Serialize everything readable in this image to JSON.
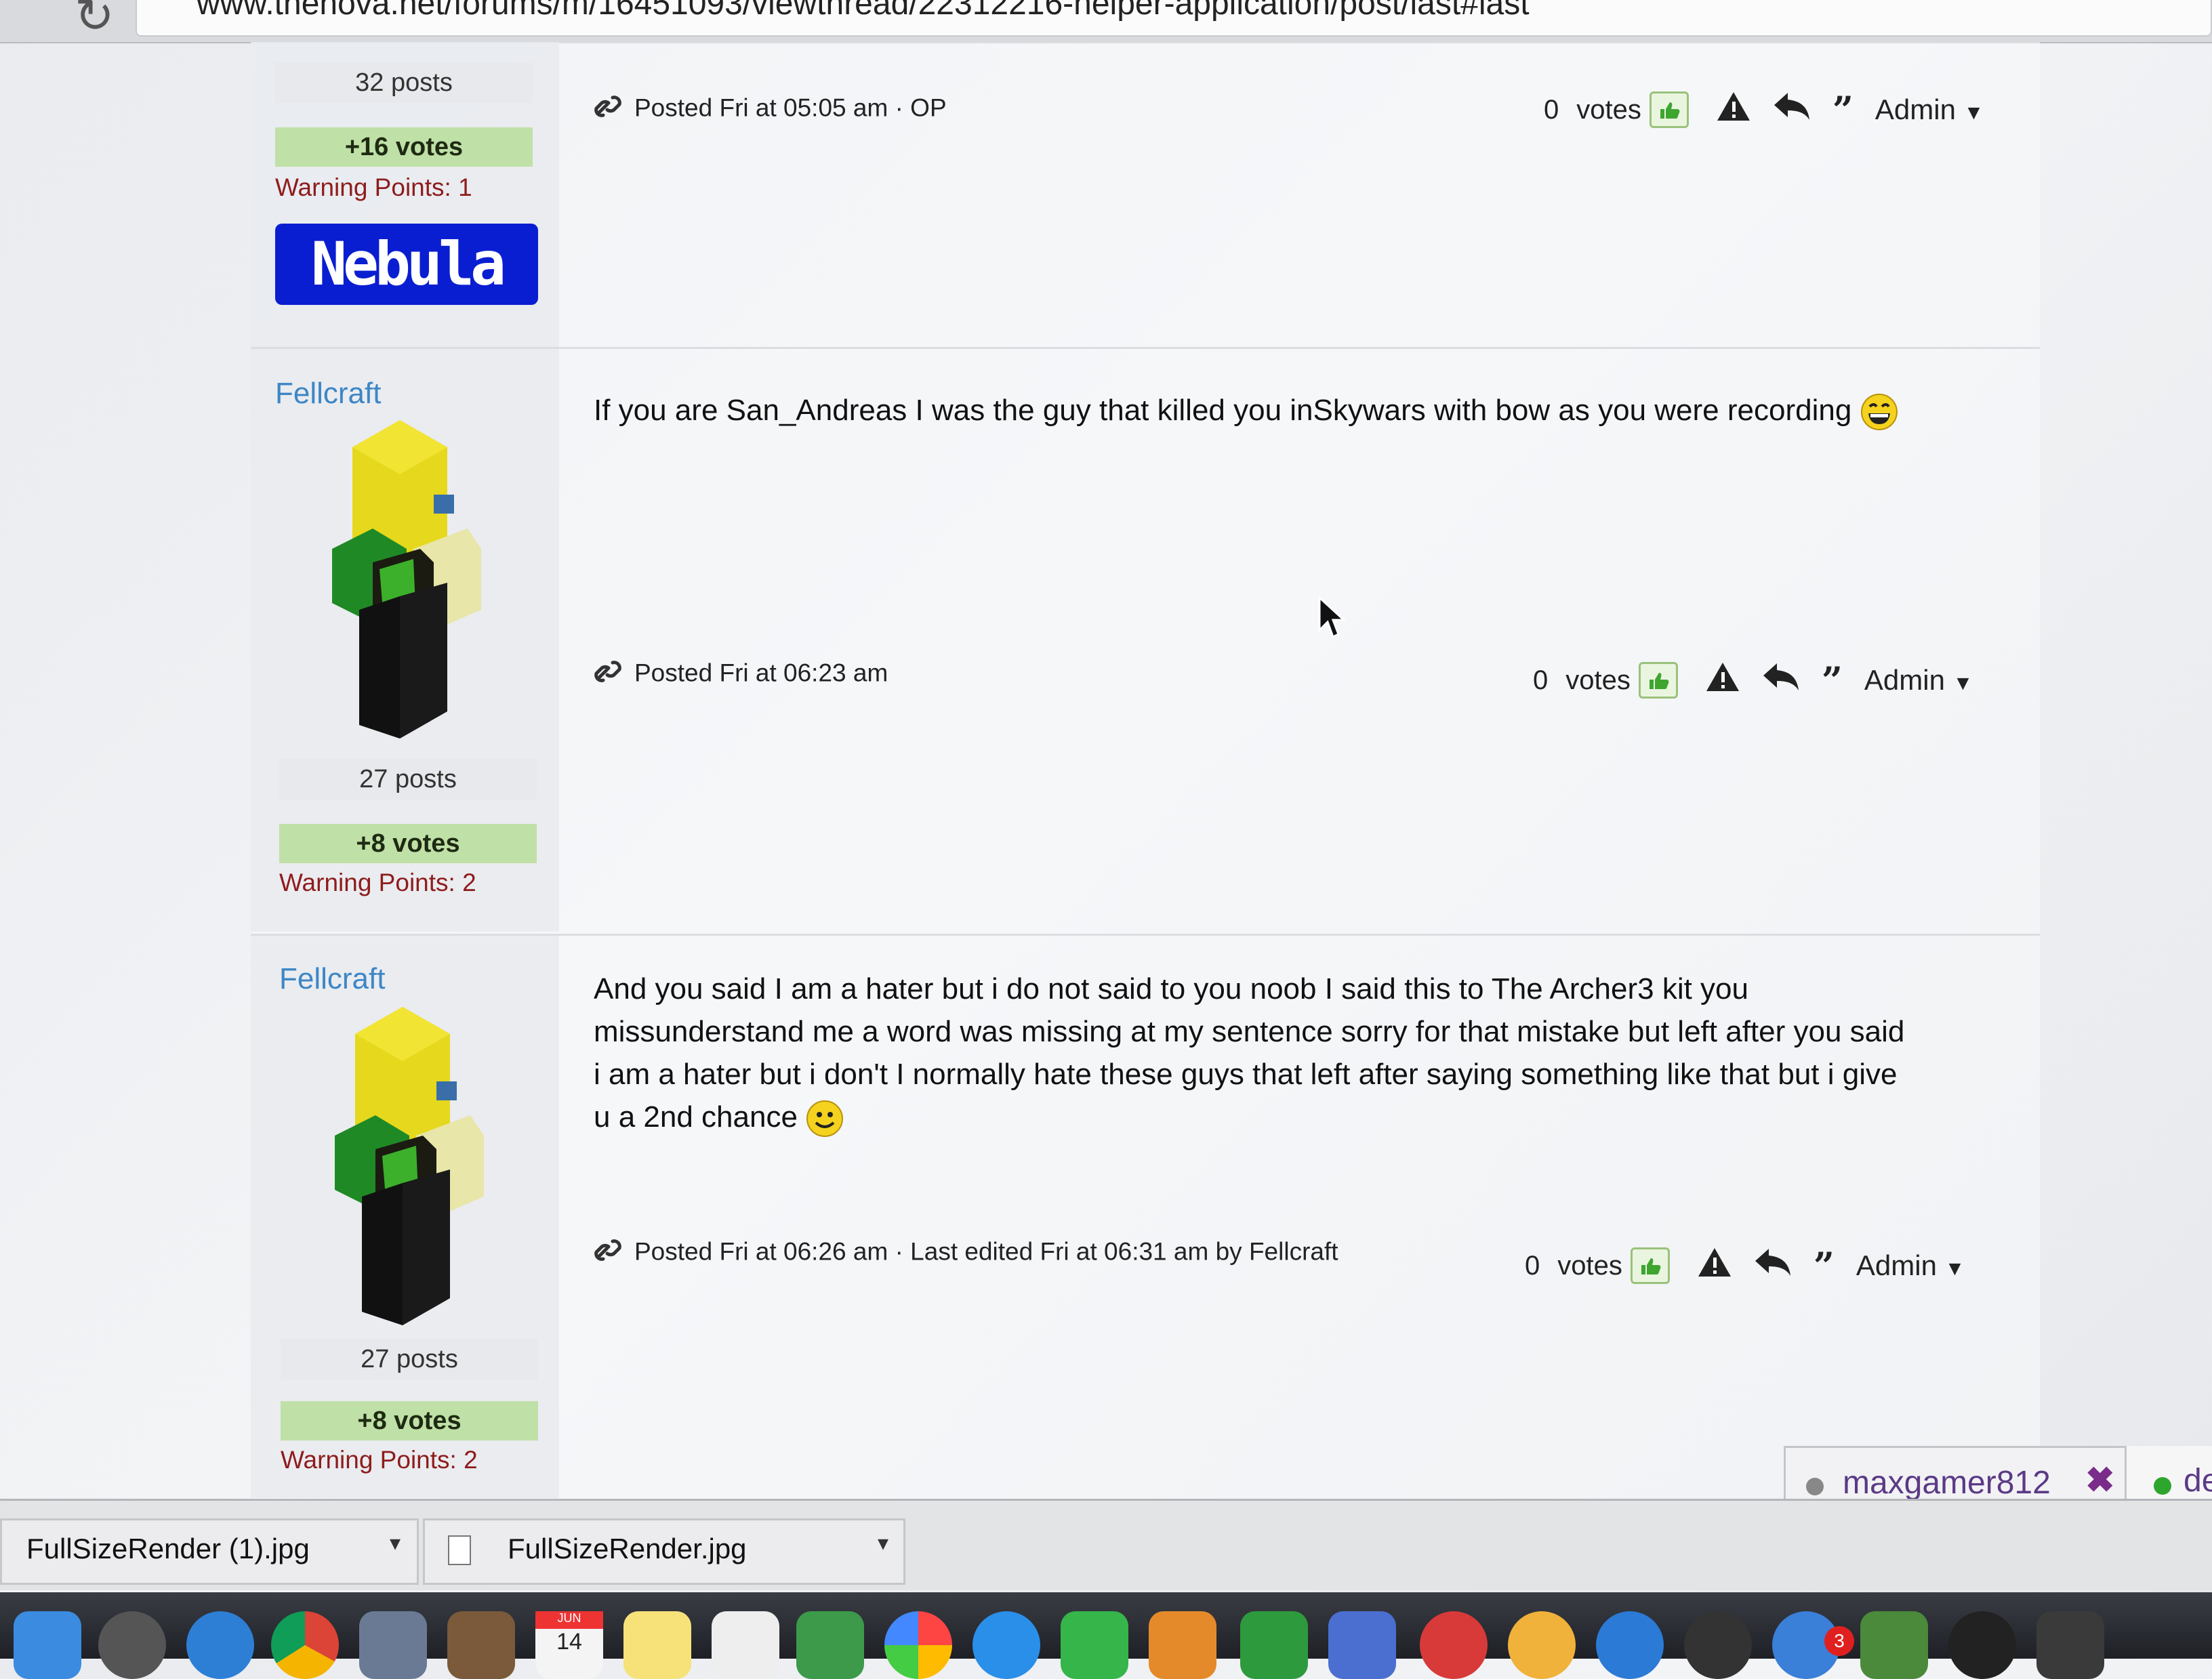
{
  "browser": {
    "url": "www.thenova.net/forums/m/16451093/viewthread/22312216-helper-application/post/last#last"
  },
  "posts": [
    {
      "author": null,
      "post_count": "32 posts",
      "votes_badge": "+16 votes",
      "warning_points": "Warning Points: 1",
      "signature_logo": "Nebula",
      "message": "",
      "posted": "Posted Fri at 05:05 am · OP",
      "votes": "0",
      "votes_label": "votes",
      "admin_label": "Admin"
    },
    {
      "author": "Fellcraft",
      "post_count": "27 posts",
      "votes_badge": "+8 votes",
      "warning_points": "Warning Points: 2",
      "message": "If you are San_Andreas I was the guy that killed you inSkywars with bow as you were recording",
      "message_emoji": "grin-emoji",
      "posted": "Posted Fri at 06:23 am",
      "votes": "0",
      "votes_label": "votes",
      "admin_label": "Admin"
    },
    {
      "author": "Fellcraft",
      "post_count": "27 posts",
      "votes_badge": "+8 votes",
      "warning_points": "Warning Points: 2",
      "message_lines": [
        "And you said I am a hater but i do not said to you noob I said this to The Archer3 kit you",
        "missunderstand me a word was missing at my sentence sorry for that mistake but left after you said",
        "i am a hater but i don't I normally hate these guys that left after saying something like that but i give",
        "u a 2nd chance"
      ],
      "message_emoji": "smile-emoji",
      "posted": "Posted Fri at 06:26 am · Last edited Fri at 06:31 am by Fellcraft",
      "votes": "0",
      "votes_label": "votes",
      "admin_label": "Admin"
    }
  ],
  "chat_tabs": [
    {
      "name": "maxgamer812",
      "status": "offline"
    },
    {
      "name": "de",
      "status": "online"
    }
  ],
  "downloads": [
    {
      "filename": "FullSizeRender (1).jpg"
    },
    {
      "filename": "FullSizeRender.jpg"
    }
  ],
  "dock": {
    "calendar_month": "JUN",
    "calendar_day": "14",
    "badge_count": "3"
  },
  "colors": {
    "username": "#3d86c6",
    "votes_badge_bg": "#bfe0a6",
    "warning": "#8e1c1c",
    "nebula_bg": "#0a1ed1",
    "chat_name": "#5b3a86"
  }
}
